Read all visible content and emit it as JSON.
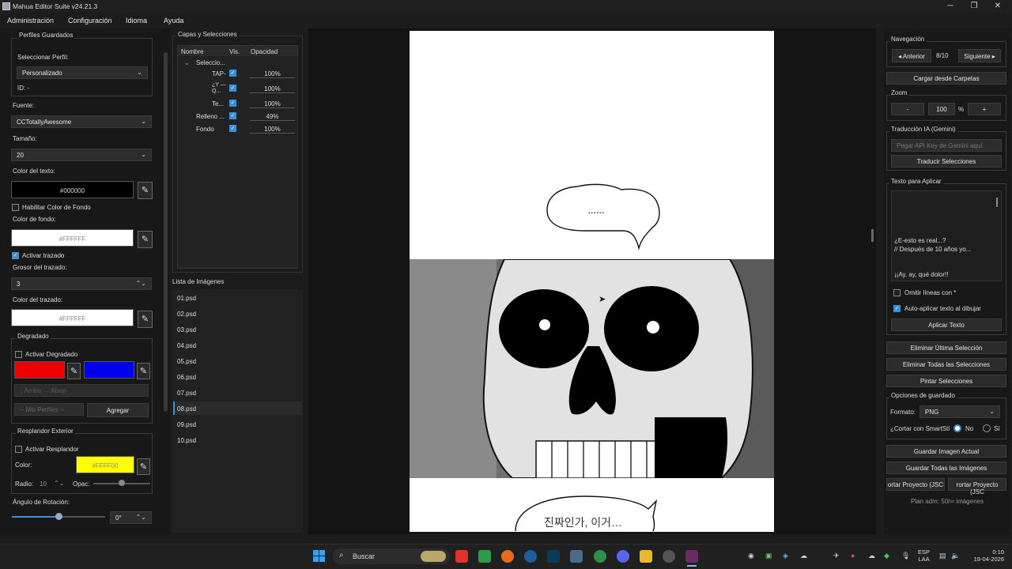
{
  "window": {
    "title": "Mahua Editor Suite v24.21.3",
    "minimize": "─",
    "restore": "❐",
    "close": "✕"
  },
  "menu": [
    "Administración",
    "Configuración",
    "Idioma",
    "Ayuda"
  ],
  "left": {
    "profiles_title": "Perfiles Guardados",
    "select_profile_label": "Seleccionar Perfil:",
    "profile_value": "Personalizado",
    "id_label": "ID: -",
    "font_label": "Fuente:",
    "font_value": "CCTotallyAwesome",
    "size_label": "Tamaño:",
    "size_value": "20",
    "text_color_label": "Color del texto:",
    "text_color_value": "#000000",
    "enable_bg_label": "Habilitar Color de Fondo",
    "bg_color_label": "Color de fondo:",
    "bg_color_value": "#FFFFFF",
    "stroke_enable_label": "Activar trazado",
    "stroke_width_label": "Grosor del trazado:",
    "stroke_width_value": "3",
    "stroke_color_label": "Color del trazado:",
    "stroke_color_value": "#FFFFFF",
    "gradient_title": "Degradado",
    "gradient_enable_label": "Activar Degradado",
    "gradient_dir": "↓ Arriba → Abajo",
    "gradient_profiles": "-- Mis Perfiles --",
    "add_label": "Agregar",
    "glow_title": "Resplandor Exterior",
    "glow_enable_label": "Activar Resplandor",
    "glow_color_label": "Color:",
    "glow_color_value": "#FFFF00",
    "radius_label": "Radio:",
    "radius_value": "10",
    "opacity_label": "Opac:",
    "rotation_label": "Ángulo de Rotación:",
    "rotation_value": "0°"
  },
  "layers": {
    "title": "Capas y Selecciones",
    "headers": [
      "Nombre",
      "Vis.",
      "Opacidad"
    ],
    "group": "Seleccio...",
    "rows": [
      {
        "name": "TAP-",
        "opacity": "100%"
      },
      {
        "name": "¿Y — Q...",
        "opacity": "100%"
      },
      {
        "name": "Te...",
        "opacity": "100%"
      },
      {
        "name": "Relleno ...",
        "opacity": "49%"
      },
      {
        "name": "Fondo",
        "opacity": "100%"
      }
    ]
  },
  "images": {
    "title": "Lista de Imágenes",
    "items": [
      "01.psd",
      "02.psd",
      "03.psd",
      "04.psd",
      "05.psd",
      "06.psd",
      "07.psd",
      "08.psd",
      "09.psd",
      "10.psd"
    ],
    "selected": "08.psd"
  },
  "canvas": {
    "bubble_top": "......",
    "bubble_bottom": "진짜인가, 이거…"
  },
  "right": {
    "nav_title": "Navegación",
    "prev": "◂ Anterior",
    "page": "8/10",
    "next": "Siguiente ▸",
    "load_folders": "Cargar desde Carpetas",
    "zoom_title": "Zoom",
    "zoom_minus": "-",
    "zoom_value": "100",
    "zoom_pct": "%",
    "zoom_plus": "+",
    "ai_title": "Traducción IA (Gemini)",
    "api_placeholder": "Pegar API Key de Gemini aquí",
    "translate": "Traducir Selecciones",
    "text_title": "Texto para Aplicar",
    "text_lines": [
      "¿E-esto es real...?",
      "// Después de 10 años yo...",
      "",
      "¡¡Ay, ay, qué dolor!!"
    ],
    "omit_lines": "Omitir líneas con *",
    "auto_apply": "Auto-aplicar texto al dibujar",
    "apply_text": "Aplicar Texto",
    "del_last": "Eliminar Última Selección",
    "del_all": "Eliminar Todas las Selecciones",
    "paint": "Pintar Selecciones",
    "save_title": "Opciones de guardado",
    "format_label": "Formato:",
    "format_value": "PNG",
    "smart_label": "¿Cortar con SmartSti",
    "no": "No",
    "yes": "Sí",
    "save_current": "Guardar Imagen Actual",
    "save_all": "Guardar Todas las Imágenes",
    "export1": "ortar Proyecto (JSC",
    "export2": "rortar Proyecto (JSC",
    "plan": "Plan adm: 50/∞ imágenes"
  },
  "taskbar": {
    "search": "Buscar",
    "lang1": "ESP",
    "lang2": "LAA",
    "time": "0:10",
    "date": "19-04-2026"
  }
}
